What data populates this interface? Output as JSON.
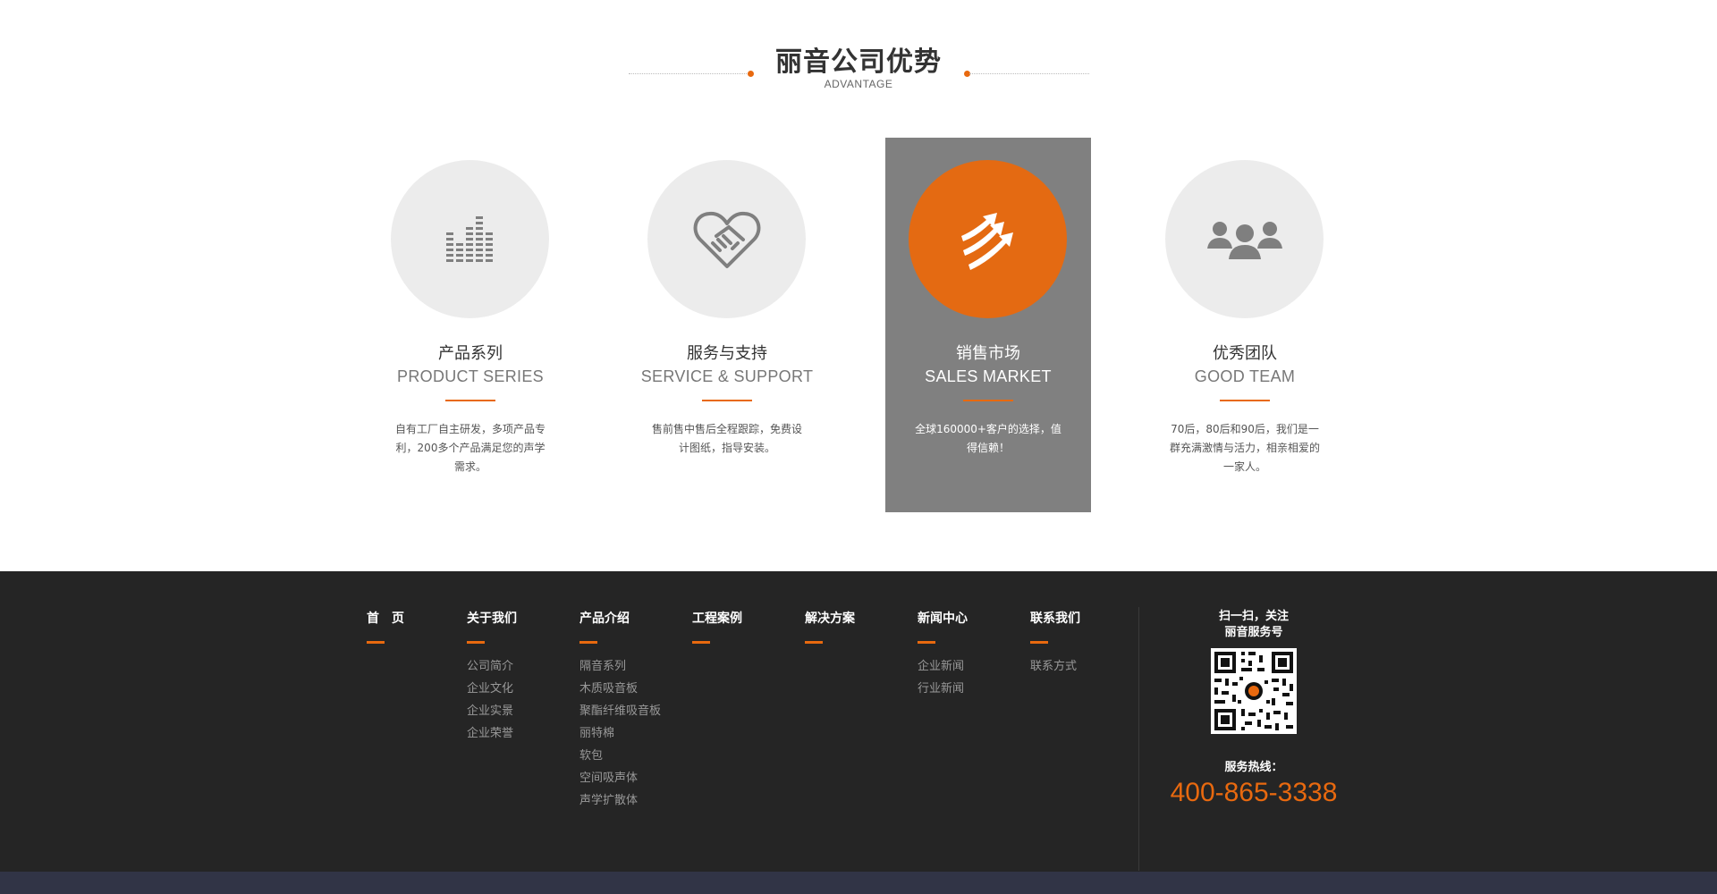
{
  "advantage": {
    "title": "丽音公司优势",
    "subtitle": "ADVANTAGE",
    "cards": [
      {
        "icon": "equalizer-icon",
        "title_cn": "产品系列",
        "title_en": "PRODUCT SERIES",
        "desc": "自有工厂自主研发，多项产品专利，200多个产品满足您的声学需求。"
      },
      {
        "icon": "handshake-icon",
        "title_cn": "服务与支持",
        "title_en": "SERVICE & SUPPORT",
        "desc": "售前售中售后全程跟踪，免费设计图纸，指导安装。"
      },
      {
        "icon": "growth-arrows-icon",
        "title_cn": "销售市场",
        "title_en": "SALES MARKET",
        "desc": "全球160000+客户的选择，值得信赖！",
        "active": true
      },
      {
        "icon": "team-icon",
        "title_cn": "优秀团队",
        "title_en": "GOOD TEAM",
        "desc": "70后，80后和90后，我们是一群充满激情与活力，相亲相爱的一家人。"
      }
    ]
  },
  "footer": {
    "columns": [
      {
        "title": "首　页",
        "items": []
      },
      {
        "title": "关于我们",
        "items": [
          "公司简介",
          "企业文化",
          "企业实景",
          "企业荣誉"
        ]
      },
      {
        "title": "产品介绍",
        "items": [
          "隔音系列",
          "木质吸音板",
          "聚酯纤维吸音板",
          "丽特棉",
          "软包",
          "空间吸声体",
          "声学扩散体"
        ]
      },
      {
        "title": "工程案例",
        "items": []
      },
      {
        "title": "解决方案",
        "items": []
      },
      {
        "title": "新闻中心",
        "items": [
          "企业新闻",
          "行业新闻"
        ]
      },
      {
        "title": "联系我们",
        "items": [
          "联系方式"
        ]
      }
    ],
    "qr_title_line1": "扫一扫，关注",
    "qr_title_line2": "丽音服务号",
    "hotline_label": "服务热线：",
    "hotline": "400-865-3338"
  },
  "colors": {
    "accent": "#e8690f",
    "active_card": "#808080",
    "footer_bg": "#252525",
    "bottom_bar": "#313446"
  }
}
